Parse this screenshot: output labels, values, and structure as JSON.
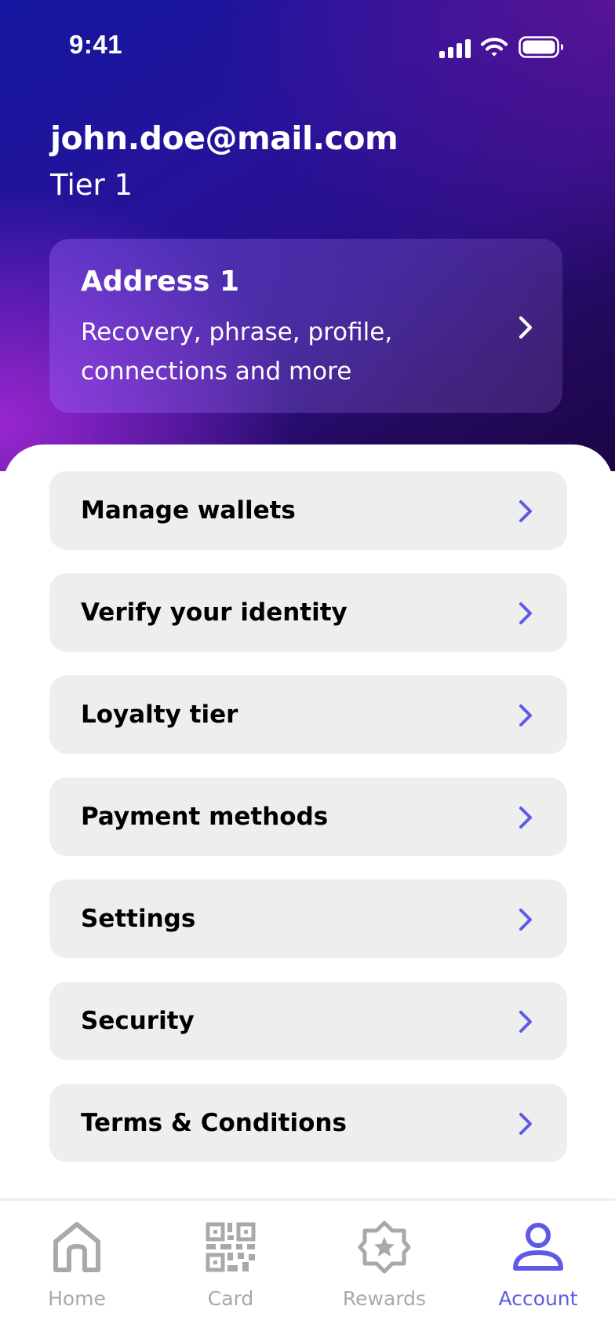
{
  "status_bar": {
    "time": "9:41",
    "icons": [
      "signal-bars-icon",
      "wifi-icon",
      "battery-icon"
    ]
  },
  "profile": {
    "email": "john.doe@mail.com",
    "tier": "Tier 1"
  },
  "address_card": {
    "title": "Address 1",
    "description": "Recovery, phrase, profile, connections and more",
    "icon": "chevron-right-icon"
  },
  "menu": {
    "items": [
      {
        "label": "Manage wallets"
      },
      {
        "label": "Verify your identity"
      },
      {
        "label": "Loyalty tier"
      },
      {
        "label": "Payment methods"
      },
      {
        "label": "Settings"
      },
      {
        "label": "Security"
      },
      {
        "label": "Terms & Conditions"
      }
    ],
    "chevron_icon": "chevron-right-icon"
  },
  "tab_bar": {
    "tabs": [
      {
        "label": "Home",
        "icon": "home-icon",
        "active": false
      },
      {
        "label": "Card",
        "icon": "qr-code-icon",
        "active": false
      },
      {
        "label": "Rewards",
        "icon": "star-badge-icon",
        "active": false
      },
      {
        "label": "Account",
        "icon": "user-icon",
        "active": true
      }
    ]
  },
  "colors": {
    "accent": "#5d5be6",
    "hero_gradient_start": "#14169f",
    "hero_gradient_end": "#1c0546",
    "menu_item_background": "#eeeeee",
    "inactive_tab": "#a9a9a9"
  }
}
